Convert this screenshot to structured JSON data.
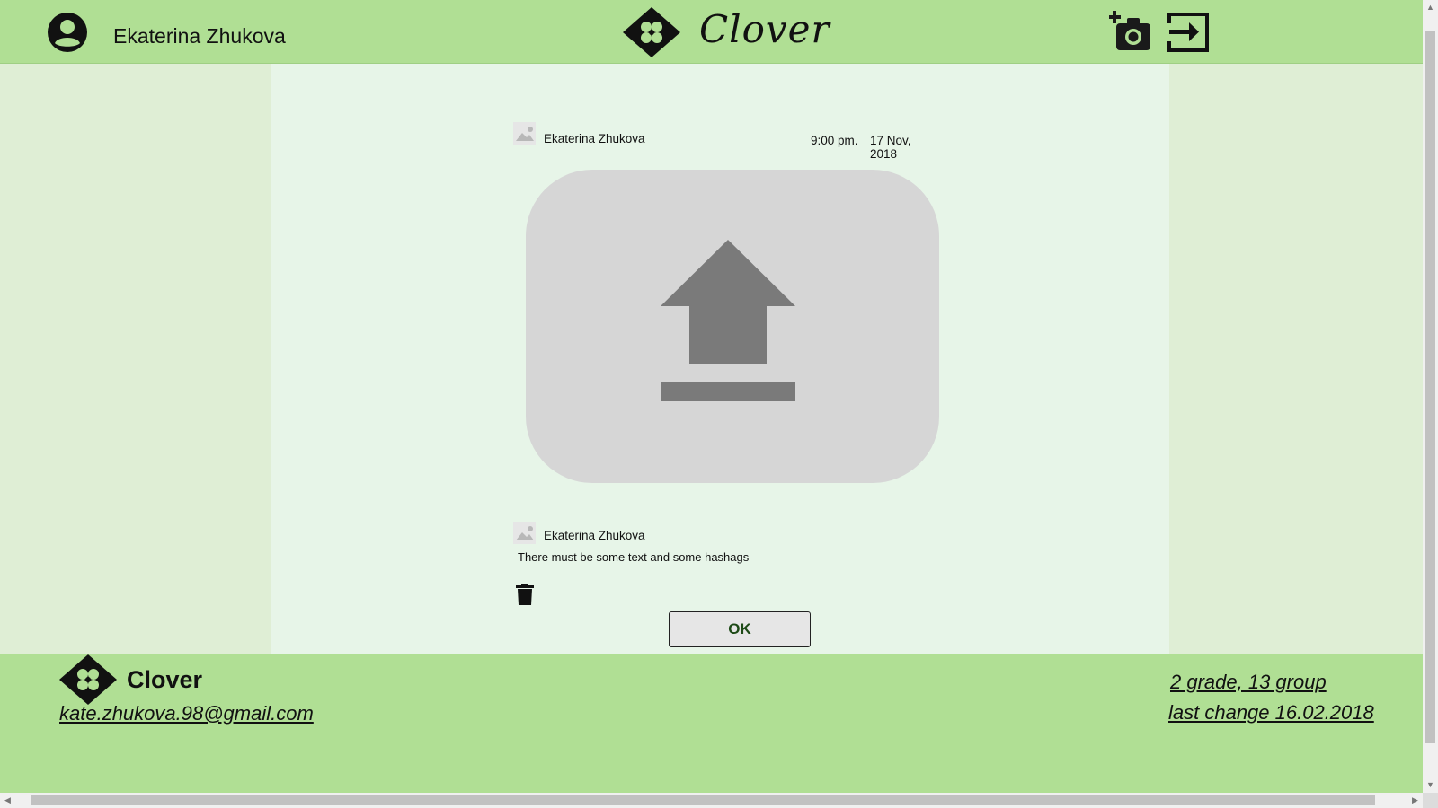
{
  "header": {
    "user_name": "Ekaterina Zhukova",
    "brand": "Clover",
    "user_icon": "account-circle-icon",
    "camera_icon": "add-photo-icon",
    "exit_icon": "login-icon"
  },
  "post": {
    "author": "Ekaterina Zhukova",
    "time": "9:00 pm.",
    "date": "17 Nov, 2018",
    "upload_icon": "upload-icon"
  },
  "comment": {
    "author": "Ekaterina Zhukova",
    "text": "There must be some text and some hashags"
  },
  "actions": {
    "delete_icon": "trash-icon",
    "ok_label": "OK"
  },
  "footer": {
    "brand": "Clover",
    "email": "kate.zhukova.98@gmail.com",
    "grade": "2 grade, 13 group",
    "last_change": "last change 16.02.2018"
  },
  "colors": {
    "header_bg": "#b0df94",
    "main_bg": "#e7f5e8",
    "side_bg": "#dfeed5",
    "upload_bg": "#d6d6d6",
    "upload_icon": "#7a7a7a"
  }
}
